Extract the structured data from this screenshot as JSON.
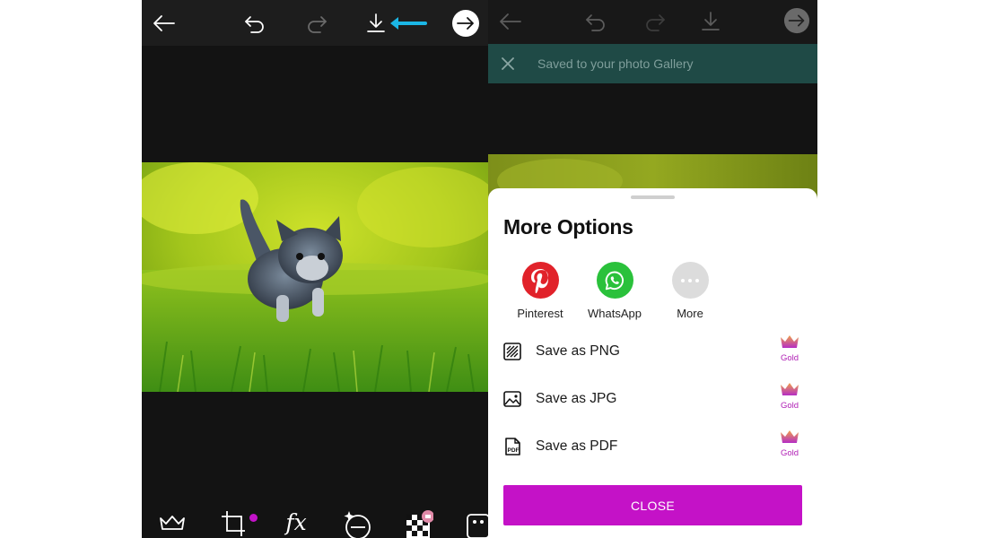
{
  "left_panel": {
    "toolbar": {
      "back_icon": "arrow-left-icon",
      "undo_icon": "undo-icon",
      "redo_icon": "redo-icon",
      "download_icon": "download-icon",
      "next_icon": "arrow-right-circle-icon",
      "highlight_arrow_color": "#1bb6e5"
    },
    "bottom_tools": [
      {
        "icon": "crown-icon"
      },
      {
        "icon": "crop-icon"
      },
      {
        "icon": "fx-icon",
        "label": "fx"
      },
      {
        "icon": "sticker-face-icon"
      },
      {
        "icon": "background-checker-icon"
      },
      {
        "icon": "sticker-icon"
      }
    ],
    "photo": {
      "subject": "kitten-on-grass-photo"
    }
  },
  "right_panel": {
    "toast": {
      "message": "Saved to your photo Gallery"
    },
    "sheet": {
      "title": "More Options",
      "share_targets": [
        {
          "label": "Pinterest",
          "icon": "pinterest-icon",
          "color": "#e1222a"
        },
        {
          "label": "WhatsApp",
          "icon": "whatsapp-icon",
          "color": "#2ac13b"
        },
        {
          "label": "More",
          "icon": "more-dots-icon",
          "color": "#dcdcdc"
        }
      ],
      "save_options": [
        {
          "label": "Save as PNG",
          "icon": "png-hatch-icon",
          "badge": "Gold"
        },
        {
          "label": "Save as JPG",
          "icon": "image-icon",
          "badge": "Gold"
        },
        {
          "label": "Save as PDF",
          "icon": "pdf-file-icon",
          "badge": "Gold"
        }
      ],
      "close_label": "CLOSE",
      "accent_color": "#c412c7"
    }
  }
}
